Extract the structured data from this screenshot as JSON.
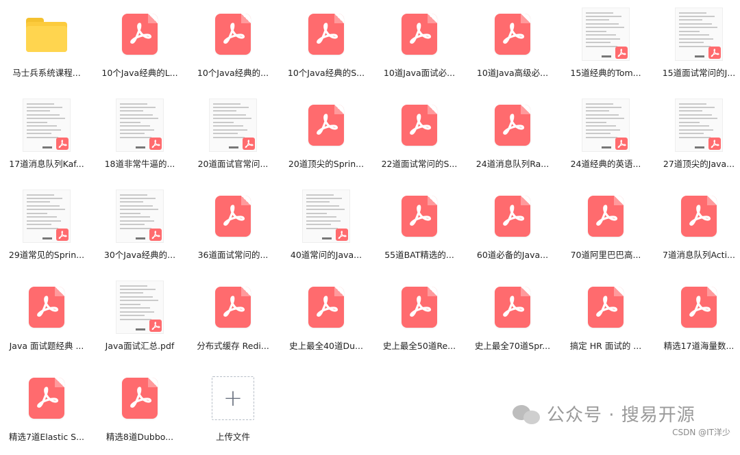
{
  "files": [
    {
      "name": "马士兵系统课程...",
      "kind": "folder"
    },
    {
      "name": "10个Java经典的L...",
      "kind": "pdf"
    },
    {
      "name": "10个Java经典的...",
      "kind": "pdf"
    },
    {
      "name": "10个Java经典的S...",
      "kind": "pdf"
    },
    {
      "name": "10道Java面试必...",
      "kind": "pdf"
    },
    {
      "name": "10道Java高级必...",
      "kind": "pdf"
    },
    {
      "name": "15道经典的Tom...",
      "kind": "thumb"
    },
    {
      "name": "15道面试常问的J...",
      "kind": "thumb"
    },
    {
      "name": "17道消息队列Kaf...",
      "kind": "thumb"
    },
    {
      "name": "18道非常牛逼的...",
      "kind": "thumb"
    },
    {
      "name": "20道面试官常问...",
      "kind": "thumb"
    },
    {
      "name": "20道顶尖的Sprin...",
      "kind": "pdf"
    },
    {
      "name": "22道面试常问的S...",
      "kind": "pdf"
    },
    {
      "name": "24道消息队列Ra...",
      "kind": "pdf"
    },
    {
      "name": "24道经典的英语...",
      "kind": "thumb"
    },
    {
      "name": "27道顶尖的Java...",
      "kind": "thumb"
    },
    {
      "name": "29道常见的Sprin...",
      "kind": "thumb"
    },
    {
      "name": "30个Java经典的...",
      "kind": "thumb"
    },
    {
      "name": "36道面试常问的...",
      "kind": "pdf"
    },
    {
      "name": "40道常问的Java...",
      "kind": "thumb"
    },
    {
      "name": "55道BAT精选的...",
      "kind": "pdf"
    },
    {
      "name": "60道必备的Java...",
      "kind": "pdf"
    },
    {
      "name": "70道阿里巴巴高...",
      "kind": "pdf"
    },
    {
      "name": "7道消息队列Acti...",
      "kind": "pdf"
    },
    {
      "name": "Java 面试题经典 ...",
      "kind": "pdf"
    },
    {
      "name": "Java面试汇总.pdf",
      "kind": "thumb"
    },
    {
      "name": "分布式缓存 Redi...",
      "kind": "pdf"
    },
    {
      "name": "史上最全40道Du...",
      "kind": "pdf"
    },
    {
      "name": "史上最全50道Re...",
      "kind": "pdf"
    },
    {
      "name": "史上最全70道Spr...",
      "kind": "pdf"
    },
    {
      "name": "搞定 HR 面试的 ...",
      "kind": "pdf"
    },
    {
      "name": "精选17道海量数...",
      "kind": "pdf"
    },
    {
      "name": "精选7道Elastic S...",
      "kind": "pdf"
    },
    {
      "name": "精选8道Dubbo...",
      "kind": "pdf"
    },
    {
      "name": "上传文件",
      "kind": "upload"
    }
  ],
  "watermark": {
    "text": "公众号 · 搜易开源"
  },
  "credit": "CSDN @IT洋少",
  "colors": {
    "pdf": "#ff6b6e",
    "folder": "#fccb3d"
  }
}
